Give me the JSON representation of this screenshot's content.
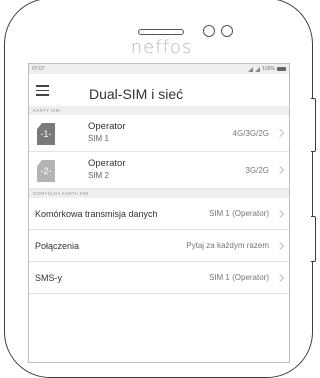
{
  "device": {
    "brand": "neffos"
  },
  "statusbar": {
    "time": "07:07",
    "battery": "100%"
  },
  "header": {
    "title": "Dual-SIM i sieć"
  },
  "sections": {
    "sim_cards": "KARTY SIM",
    "default_sim": "DOMYŚLNA KARTA SIM"
  },
  "sims": [
    {
      "icon_label": "-1-",
      "operator": "Operator",
      "slot": "SIM 1",
      "network": "4G/3G/2G"
    },
    {
      "icon_label": "-2-",
      "operator": "Operator",
      "slot": "SIM 2",
      "network": "3G/2G"
    }
  ],
  "defaults": [
    {
      "label": "Komórkowa transmisja danych",
      "value": "SIM 1 (Operator)"
    },
    {
      "label": "Połączenia",
      "value": "Pytaj za każdym razem"
    },
    {
      "label": "SMS-y",
      "value": "SIM 1 (Operator)"
    }
  ]
}
